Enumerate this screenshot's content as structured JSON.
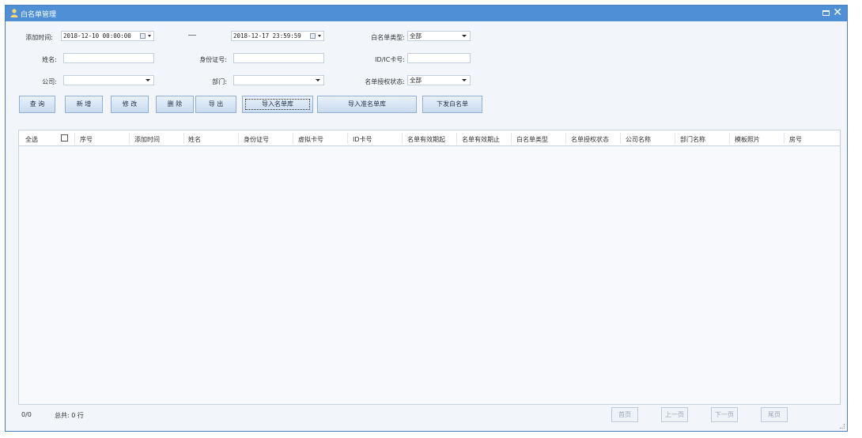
{
  "window": {
    "title": "白名单管理"
  },
  "filters": {
    "add_time_label": "添加时间:",
    "add_time_from": "2018-12-10 00:00:00",
    "range_separator": "—",
    "add_time_to": "2018-12-17 23:59:59",
    "whitelist_type_label": "白名单类型:",
    "whitelist_type_value": "全部",
    "name_label": "姓名:",
    "name_value": "",
    "id_number_label": "身份证号:",
    "id_number_value": "",
    "card_label": "ID/IC卡号:",
    "card_value": "",
    "company_label": "公司:",
    "company_value": "",
    "department_label": "部门:",
    "department_value": "",
    "auth_status_label": "名单授权状态:",
    "auth_status_value": "全部"
  },
  "toolbar": {
    "query": "查 询",
    "add": "新 增",
    "edit": "修 改",
    "delete": "删 除",
    "export": "导 出",
    "import_list": "导入名单库",
    "import_quasi_list": "导入准名单库",
    "issue_whitelist": "下发白名单"
  },
  "table": {
    "select_all": "全选",
    "columns": [
      "序号",
      "添加时间",
      "姓名",
      "身份证号",
      "虚拟卡号",
      "ID卡号",
      "名单有效期起",
      "名单有效期止",
      "白名单类型",
      "名单授权状态",
      "公司名称",
      "部门名称",
      "模板照片",
      "房号"
    ],
    "rows": []
  },
  "footer": {
    "count": "0/0",
    "total": "总共: 0 行",
    "first_page": "首页",
    "prev_page": "上一页",
    "next_page": "下一页",
    "last_page": "尾页"
  },
  "colors": {
    "titlebar": "#4f8fd6",
    "background": "#f2f6fb",
    "button_border": "#8fb0d4"
  },
  "icons": [
    "user-icon",
    "maximize-icon",
    "close-icon",
    "calendar-icon",
    "dropdown-icon",
    "checkbox-icon"
  ]
}
